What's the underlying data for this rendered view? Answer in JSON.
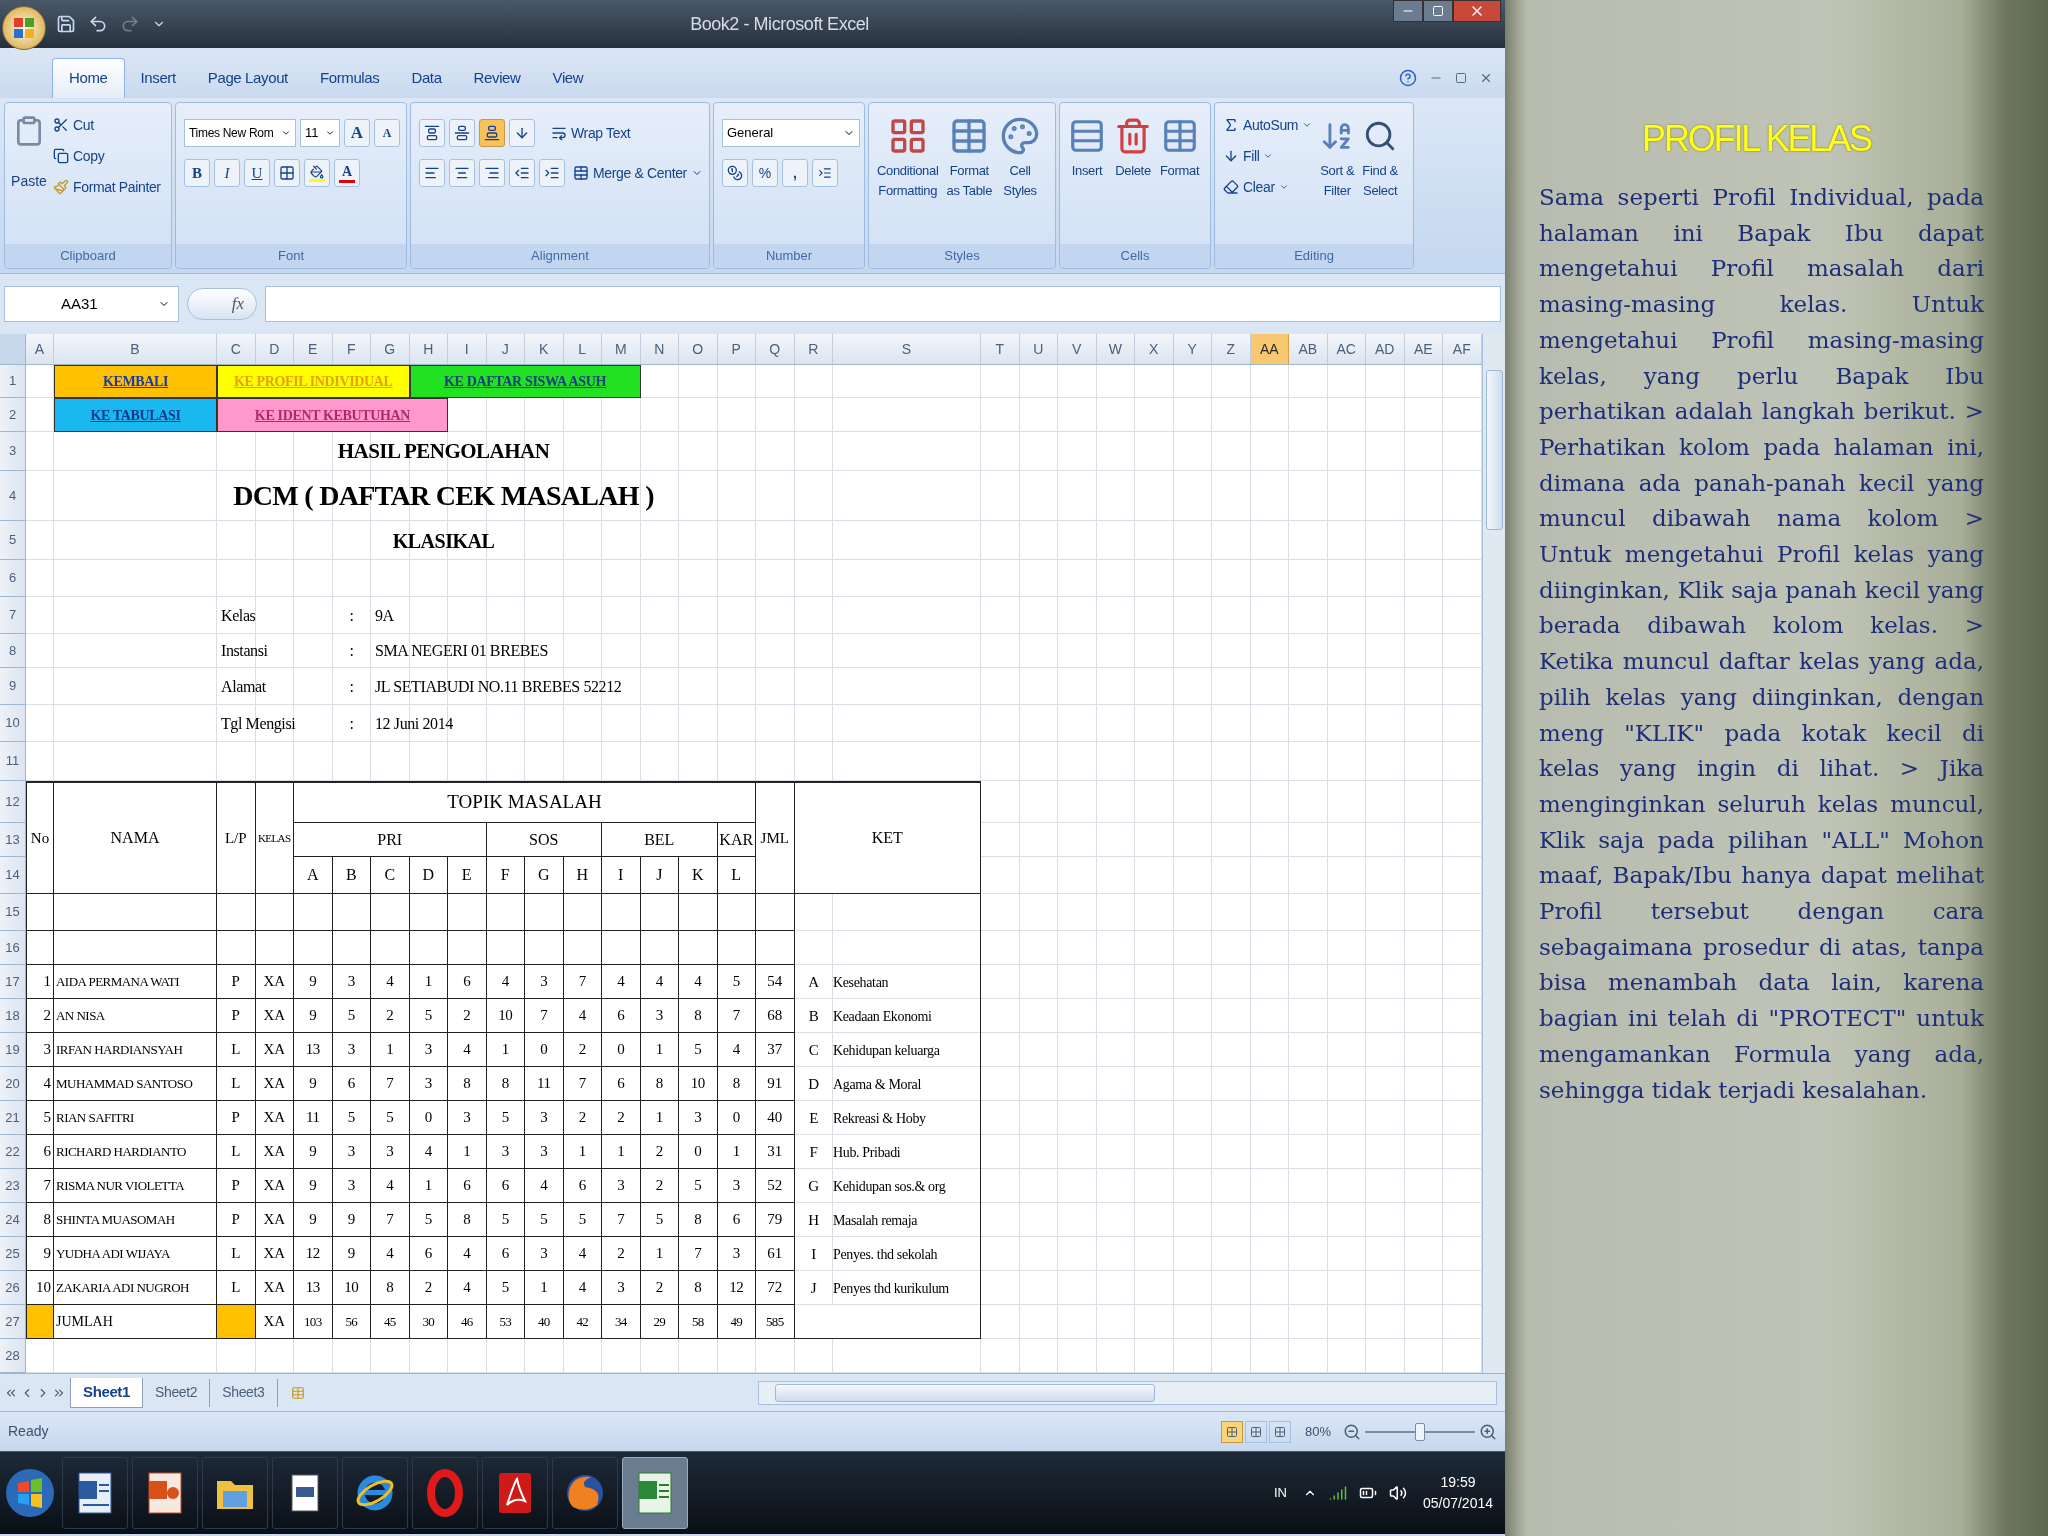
{
  "window": {
    "title": "Book2 - Microsoft Excel"
  },
  "ribbon_tabs": [
    {
      "label": "Home",
      "selected": true
    },
    {
      "label": "Insert",
      "selected": false
    },
    {
      "label": "Page Layout",
      "selected": false
    },
    {
      "label": "Formulas",
      "selected": false
    },
    {
      "label": "Data",
      "selected": false
    },
    {
      "label": "Review",
      "selected": false
    },
    {
      "label": "View",
      "selected": false
    }
  ],
  "ribbon_groups": [
    {
      "label": "Clipboard",
      "buttons": [
        "Paste",
        "Cut",
        "Copy",
        "Format Painter"
      ]
    },
    {
      "label": "Font",
      "font": "Times New Rom",
      "size": "11",
      "grow_shrink": [
        "A",
        "A"
      ],
      "styles": [
        "B",
        "I",
        "U"
      ],
      "font_color": "A"
    },
    {
      "label": "Alignment",
      "valign": [
        {
          "selected": false
        },
        {
          "selected": false
        },
        {
          "selected": true
        }
      ],
      "buttons": [
        "Wrap Text",
        "Merge & Center"
      ]
    },
    {
      "label": "Number",
      "format": "General",
      "glyphs": [
        "%",
        ","
      ]
    },
    {
      "label": "Styles",
      "buttons": [
        [
          "Conditional",
          "Formatting"
        ],
        [
          "Format",
          "as Table"
        ],
        [
          "Cell",
          "Styles"
        ]
      ]
    },
    {
      "label": "Cells",
      "buttons": [
        "Insert",
        "Delete",
        "Format"
      ]
    },
    {
      "label": "Editing",
      "small": [
        "AutoSum",
        "Fill",
        "Clear"
      ],
      "large": [
        [
          "Sort &",
          "Filter"
        ],
        [
          "Find &",
          "Select"
        ]
      ]
    }
  ],
  "formula_bar": {
    "name_box": "AA31",
    "function_label": "fx"
  },
  "columns": [
    {
      "label": "A",
      "selected": false
    },
    {
      "label": "B",
      "selected": false
    },
    {
      "label": "C",
      "selected": false
    },
    {
      "label": "D",
      "selected": false
    },
    {
      "label": "E",
      "selected": false
    },
    {
      "label": "F",
      "selected": false
    },
    {
      "label": "G",
      "selected": false
    },
    {
      "label": "H",
      "selected": false
    },
    {
      "label": "I",
      "selected": false
    },
    {
      "label": "J",
      "selected": false
    },
    {
      "label": "K",
      "selected": false
    },
    {
      "label": "L",
      "selected": false
    },
    {
      "label": "M",
      "selected": false
    },
    {
      "label": "N",
      "selected": false
    },
    {
      "label": "O",
      "selected": false
    },
    {
      "label": "P",
      "selected": false
    },
    {
      "label": "Q",
      "selected": false
    },
    {
      "label": "R",
      "selected": false
    },
    {
      "label": "S",
      "selected": false
    },
    {
      "label": "T",
      "selected": false
    },
    {
      "label": "U",
      "selected": false
    },
    {
      "label": "V",
      "selected": false
    },
    {
      "label": "W",
      "selected": false
    },
    {
      "label": "X",
      "selected": false
    },
    {
      "label": "Y",
      "selected": false
    },
    {
      "label": "Z",
      "selected": false
    },
    {
      "label": "AA",
      "selected": true
    },
    {
      "label": "AB",
      "selected": false
    },
    {
      "label": "AC",
      "selected": false
    },
    {
      "label": "AD",
      "selected": false
    },
    {
      "label": "AE",
      "selected": false
    },
    {
      "label": "AF",
      "selected": false
    }
  ],
  "row_numbers": [
    "1",
    "2",
    "3",
    "4",
    "5",
    "6",
    "7",
    "8",
    "9",
    "10",
    "11",
    "12",
    "13",
    "14",
    "15",
    "16",
    "17",
    "18",
    "19",
    "20",
    "21",
    "22",
    "23",
    "24",
    "25",
    "26",
    "27",
    "28"
  ],
  "links": [
    {
      "text": "KEMBALI",
      "color": "#ffc000"
    },
    {
      "text": "KE PROFIL INDIVIDUAL",
      "color": "#ffff00"
    },
    {
      "text": "KE DAFTAR SISWA ASUH",
      "color": "#22e022"
    },
    {
      "text": "KE TABULASI",
      "color": "#1ab8f0"
    },
    {
      "text": "KE IDENT KEBUTUHAN",
      "color": "#ff99cc"
    }
  ],
  "titles": [
    "HASIL PENGOLAHAN",
    "DCM ( DAFTAR CEK MASALAH )",
    "KLASIKAL"
  ],
  "info": [
    {
      "label": "Kelas",
      "separator": ":",
      "value": "9A"
    },
    {
      "label": "Instansi",
      "separator": ":",
      "value": "SMA NEGERI 01 BREBES"
    },
    {
      "label": "Alamat",
      "separator": ":",
      "value": "JL SETIABUDI NO.11 BREBES 52212"
    },
    {
      "label": "Tgl Mengisi",
      "separator": ":",
      "value": "12 Juni 2014"
    }
  ],
  "table": {
    "no": "No",
    "name": "NAMA",
    "sex": "L/P",
    "class": "KELAS",
    "topic": "TOPIK MASALAH",
    "total": "JML",
    "ket": "KET",
    "groups": [
      {
        "label": "PRI",
        "letters": [
          "A",
          "B",
          "C",
          "D",
          "E"
        ]
      },
      {
        "label": "SOS",
        "letters": [
          "F",
          "G",
          "H"
        ]
      },
      {
        "label": "BEL",
        "letters": [
          "I",
          "J",
          "K"
        ]
      },
      {
        "label": "KAR",
        "letters": [
          "L"
        ]
      }
    ],
    "rows": [
      {
        "no": "1",
        "name": "AIDA PERMANA WATI",
        "sex": "P",
        "class": "XA",
        "values": [
          "9",
          "3",
          "4",
          "1",
          "6",
          "4",
          "3",
          "7",
          "4",
          "4",
          "4",
          "5"
        ],
        "total": "54"
      },
      {
        "no": "2",
        "name": "AN NISA",
        "sex": "P",
        "class": "XA",
        "values": [
          "9",
          "5",
          "2",
          "5",
          "2",
          "10",
          "7",
          "4",
          "6",
          "3",
          "8",
          "7"
        ],
        "total": "68"
      },
      {
        "no": "3",
        "name": "IRFAN HARDIANSYAH",
        "sex": "L",
        "class": "XA",
        "values": [
          "13",
          "3",
          "1",
          "3",
          "4",
          "1",
          "0",
          "2",
          "0",
          "1",
          "5",
          "4"
        ],
        "total": "37"
      },
      {
        "no": "4",
        "name": "MUHAMMAD SANTOSO",
        "sex": "L",
        "class": "XA",
        "values": [
          "9",
          "6",
          "7",
          "3",
          "8",
          "8",
          "11",
          "7",
          "6",
          "8",
          "10",
          "8"
        ],
        "total": "91"
      },
      {
        "no": "5",
        "name": "RIAN SAFITRI",
        "sex": "P",
        "class": "XA",
        "values": [
          "11",
          "5",
          "5",
          "0",
          "3",
          "5",
          "3",
          "2",
          "2",
          "1",
          "3",
          "0"
        ],
        "total": "40"
      },
      {
        "no": "6",
        "name": "RICHARD HARDIANTO",
        "sex": "L",
        "class": "XA",
        "values": [
          "9",
          "3",
          "3",
          "4",
          "1",
          "3",
          "3",
          "1",
          "1",
          "2",
          "0",
          "1"
        ],
        "total": "31"
      },
      {
        "no": "7",
        "name": "RISMA NUR VIOLETTA",
        "sex": "P",
        "class": "XA",
        "values": [
          "9",
          "3",
          "4",
          "1",
          "6",
          "6",
          "4",
          "6",
          "3",
          "2",
          "5",
          "3"
        ],
        "total": "52"
      },
      {
        "no": "8",
        "name": "SHINTA MUASOMAH",
        "sex": "P",
        "class": "XA",
        "values": [
          "9",
          "9",
          "7",
          "5",
          "8",
          "5",
          "5",
          "5",
          "7",
          "5",
          "8",
          "6"
        ],
        "total": "79"
      },
      {
        "no": "9",
        "name": "YUDHA ADI WIJAYA",
        "sex": "L",
        "class": "XA",
        "values": [
          "12",
          "9",
          "4",
          "6",
          "4",
          "6",
          "3",
          "4",
          "2",
          "1",
          "7",
          "3"
        ],
        "total": "61"
      },
      {
        "no": "10",
        "name": "ZAKARIA ADI NUGROH",
        "sex": "L",
        "class": "XA",
        "values": [
          "13",
          "10",
          "8",
          "2",
          "4",
          "5",
          "1",
          "4",
          "3",
          "2",
          "8",
          "12"
        ],
        "total": "72"
      }
    ],
    "sum_row": {
      "label": "JUMLAH",
      "class": "XA",
      "values": [
        "103",
        "56",
        "45",
        "30",
        "46",
        "53",
        "40",
        "42",
        "34",
        "29",
        "58",
        "49"
      ],
      "total": "585"
    },
    "legend": [
      {
        "code": "A",
        "text": "Kesehatan"
      },
      {
        "code": "B",
        "text": "Keadaan Ekonomi"
      },
      {
        "code": "C",
        "text": "Kehidupan keluarga"
      },
      {
        "code": "D",
        "text": "Agama & Moral"
      },
      {
        "code": "E",
        "text": "Rekreasi & Hoby"
      },
      {
        "code": "F",
        "text": "Hub. Pribadi"
      },
      {
        "code": "G",
        "text": "Kehidupan sos.& org"
      },
      {
        "code": "H",
        "text": "Masalah remaja"
      },
      {
        "code": "I",
        "text": "Penyes. thd sekolah"
      },
      {
        "code": "J",
        "text": "Penyes thd kurikulum"
      }
    ]
  },
  "sheet_tabs": [
    {
      "label": "Sheet1",
      "selected": true
    },
    {
      "label": "Sheet2",
      "selected": false
    },
    {
      "label": "Sheet3",
      "selected": false
    }
  ],
  "status_bar": {
    "status": "Ready",
    "views": [
      {
        "selected": true
      },
      {
        "selected": false
      },
      {
        "selected": false
      }
    ],
    "zoom": "80%",
    "zoom_slider": {
      "level": 0.5
    }
  },
  "taskbar": {
    "apps": [
      {
        "selected": false
      },
      {
        "selected": false
      },
      {
        "selected": false
      },
      {
        "selected": false
      },
      {
        "selected": false
      },
      {
        "selected": false
      },
      {
        "selected": false
      },
      {
        "selected": false
      },
      {
        "selected": true
      }
    ],
    "language": "IN",
    "time": "19:59",
    "date": "05/07/2014"
  },
  "slide": {
    "title": "PROFIL KELAS",
    "body": "Sama seperti Profil Individual, pada halaman ini Bapak Ibu dapat mengetahui Profil masalah dari masing-masing kelas. Untuk mengetahui Profil masing-masing kelas, yang perlu Bapak Ibu perhatikan adalah langkah berikut. > Perhatikan kolom pada halaman ini, dimana ada panah-panah kecil yang muncul dibawah nama kolom > Untuk mengetahui Profil kelas yang diinginkan, Klik saja panah kecil yang berada dibawah kolom kelas. > Ketika muncul daftar kelas yang ada, pilih kelas yang diinginkan, dengan meng \"KLIK\" pada kotak kecil di kelas yang ingin di lihat. > Jika menginginkan seluruh kelas muncul, Klik saja pada pilihan \"ALL\" Mohon maaf, Bapak/Ibu hanya dapat melihat Profil tersebut dengan cara sebagaimana prosedur di atas, tanpa bisa menambah data lain, karena bagian ini telah di \"PROTECT\" untuk mengamankan Formula yang ada, sehingga tidak terjadi kesalahan."
  }
}
